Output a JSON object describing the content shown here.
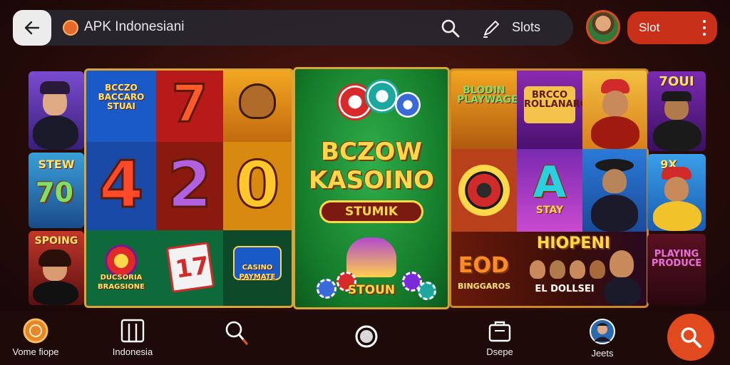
{
  "top_bar": {
    "title": "APK Indonesiani",
    "slots_label": "Slots",
    "button_label": "Slot"
  },
  "center_panel": {
    "title_line1": "BCZOW",
    "title_line2": "KASOINO",
    "ribbon": "STUMIK",
    "chip_label": "STOUN"
  },
  "reels": {
    "top_left_label": "BCCZO BACCARO STUAI",
    "digits": [
      "7",
      "4",
      "2",
      "0"
    ],
    "bottom_label_1": "DUCSORIA BRAGSIONE",
    "bottom_label_2": "17",
    "bottom_label_3": "CASINO PAYMATE"
  },
  "right_panel": {
    "game_1": "BLODIN PLAYWAGE",
    "game_2": "BRCCO ROLLANARO",
    "game_3_letter": "A",
    "game_3_sub": "STAY",
    "bottom_title": "HIOPENI",
    "bottom_left_big": "EOD",
    "bottom_left_sub": "BINGGAROS",
    "bottom_mid": "EL DOLLSEI"
  },
  "side": {
    "left_top_label": "STEW",
    "left_mid_label": "70",
    "left_bottom_label": "SPOING",
    "right_top_label": "7OUI",
    "right_mid_label": "9X",
    "right_bottom_label": "PLAYING PRODUCE"
  },
  "bottom_nav": [
    {
      "label": "Vome fiope",
      "icon": "coin-icon"
    },
    {
      "label": "Indonesia",
      "icon": "grid-icon"
    },
    {
      "label": "",
      "icon": "search-pen-icon"
    },
    {
      "label": "",
      "icon": "home-circle-icon"
    },
    {
      "label": "Dsepe",
      "icon": "bag-icon"
    },
    {
      "label": "Jeets",
      "icon": "avatar-icon"
    }
  ],
  "colors": {
    "accent": "#c9301a",
    "gold": "#ffd84a",
    "felt_green": "#1f8a3a"
  }
}
